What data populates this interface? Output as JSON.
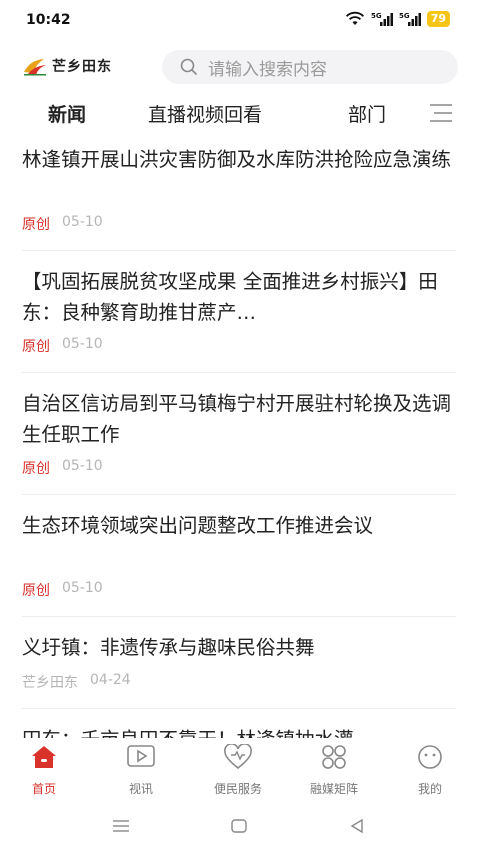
{
  "status_bar": {
    "time": "10:42",
    "signal1": "5G",
    "signal2": "5G",
    "battery": "79"
  },
  "header": {
    "logo_text": "芒乡田东",
    "search_placeholder": "请输入搜索内容"
  },
  "tabs": [
    {
      "label": "新闻",
      "active": true
    },
    {
      "label": "直播视频回看",
      "active": false
    },
    {
      "label": "部门",
      "active": false
    }
  ],
  "feed": [
    {
      "title": "林逢镇开展山洪灾害防御及水库防洪抢险应急演练",
      "tag": "原创",
      "date": "05-10"
    },
    {
      "title": "【巩固拓展脱贫攻坚成果 全面推进乡村振兴】田东：良种繁育助推甘蔗产…",
      "tag": "原创",
      "date": "05-10"
    },
    {
      "title": "自治区信访局到平马镇梅宁村开展驻村轮换及选调生任职工作",
      "tag": "原创",
      "date": "05-10"
    },
    {
      "title": "生态环境领域突出问题整改工作推进会议",
      "tag": "原创",
      "date": "05-10"
    },
    {
      "title": "义圩镇：非遗传承与趣味民俗共舞",
      "tag": "芒乡田东",
      "date": "04-24"
    },
    {
      "title": "田东：千亩良田不靠天！林逢镇抽水灌"
    }
  ],
  "bottom_nav": [
    {
      "label": "首页",
      "icon": "home-icon",
      "active": true
    },
    {
      "label": "视讯",
      "icon": "play-icon",
      "active": false
    },
    {
      "label": "便民服务",
      "icon": "heart-icon",
      "active": false
    },
    {
      "label": "融媒矩阵",
      "icon": "grid-icon",
      "active": false
    },
    {
      "label": "我的",
      "icon": "profile-icon",
      "active": false
    }
  ],
  "colors": {
    "accent": "#d8322b",
    "battery": "#f5c518",
    "muted": "#b5b5b5"
  }
}
